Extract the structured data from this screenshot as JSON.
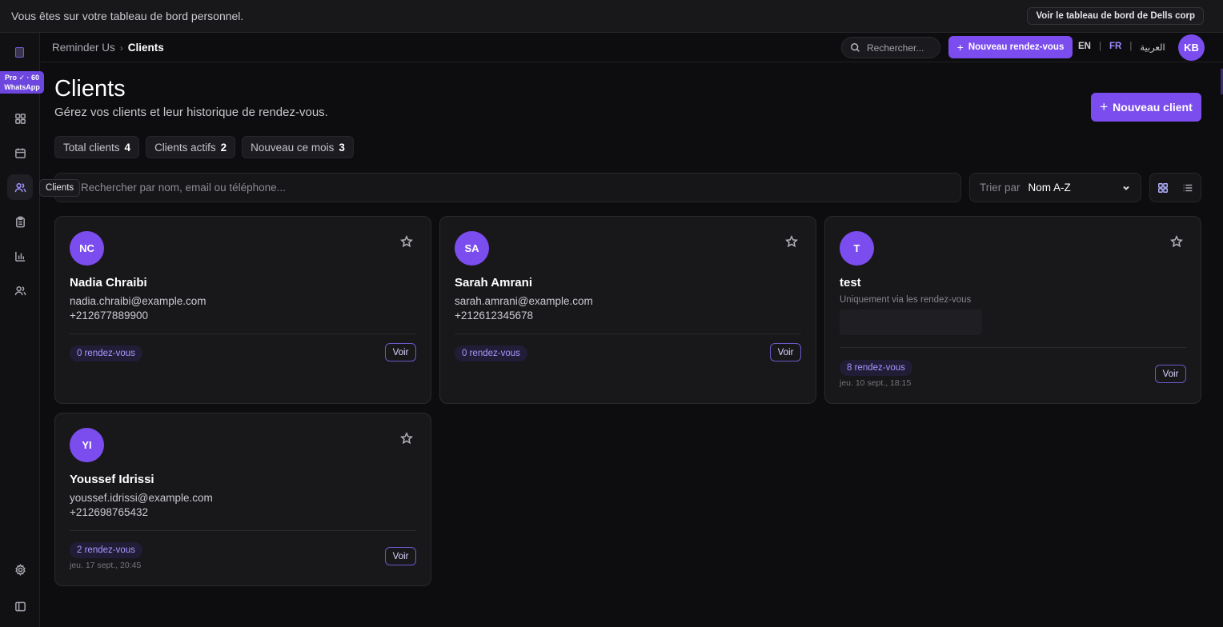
{
  "banner": {
    "message": "Vous êtes sur votre tableau de bord personnel.",
    "corp_button": "Voir le tableau de bord de Dells corp"
  },
  "sidebar": {
    "pro_badge_line1": "Pro ✓ · 60",
    "pro_badge_line2": "WhatsApp",
    "active_item": "clients",
    "tooltip": "Clients",
    "items": [
      {
        "name": "dashboard",
        "icon": "grid-icon"
      },
      {
        "name": "calendar",
        "icon": "calendar-icon"
      },
      {
        "name": "clients",
        "icon": "users-icon"
      },
      {
        "name": "tasks",
        "icon": "clipboard-icon"
      },
      {
        "name": "stats",
        "icon": "bar-chart-icon"
      },
      {
        "name": "team",
        "icon": "team-icon"
      },
      {
        "name": "settings",
        "icon": "gear-icon"
      },
      {
        "name": "collapse",
        "icon": "sidebar-toggle-icon"
      }
    ]
  },
  "header": {
    "breadcrumb_root": "Reminder Us",
    "breadcrumb_sep": "›",
    "breadcrumb_current": "Clients",
    "search_placeholder": "Rechercher...",
    "new_appointment": "Nouveau rendez-vous",
    "lang_en": "EN",
    "lang_fr": "FR",
    "lang_ar": "العربية",
    "lang_sep": "|",
    "active_lang": "FR",
    "avatar": "KB"
  },
  "page": {
    "title": "Clients",
    "subtitle": "Gérez vos clients et leur historique de rendez-vous.",
    "new_client": "Nouveau client"
  },
  "stats": [
    {
      "label": "Total clients",
      "value": "4"
    },
    {
      "label": "Clients actifs",
      "value": "2"
    },
    {
      "label": "Nouveau ce mois",
      "value": "3"
    }
  ],
  "filters": {
    "search_placeholder": "Rechercher par nom, email ou téléphone...",
    "sort_label": "Trier par",
    "sort_value": "Nom A-Z",
    "view_mode": "grid"
  },
  "clients": [
    {
      "initials": "NC",
      "name": "Nadia Chraibi",
      "email": "nadia.chraibi@example.com",
      "phone": "+212677889900",
      "appointments": "0 rendez-vous",
      "last": "",
      "action": "Voir"
    },
    {
      "initials": "SA",
      "name": "Sarah Amrani",
      "email": "sarah.amrani@example.com",
      "phone": "+212612345678",
      "appointments": "0 rendez-vous",
      "last": "",
      "action": "Voir"
    },
    {
      "initials": "T",
      "name": "test",
      "note": "Uniquement via les rendez-vous",
      "appointments": "8 rendez-vous",
      "last": "jeu. 10 sept., 18:15",
      "action": "Voir"
    },
    {
      "initials": "YI",
      "name": "Youssef Idrissi",
      "email": "youssef.idrissi@example.com",
      "phone": "+212698765432",
      "appointments": "2 rendez-vous",
      "last": "jeu. 17 sept., 20:45",
      "action": "Voir"
    }
  ],
  "colors": {
    "accent": "#7c4dee",
    "background": "#0d0d0f",
    "card": "#18181b",
    "badge_text": "#a996ff"
  }
}
